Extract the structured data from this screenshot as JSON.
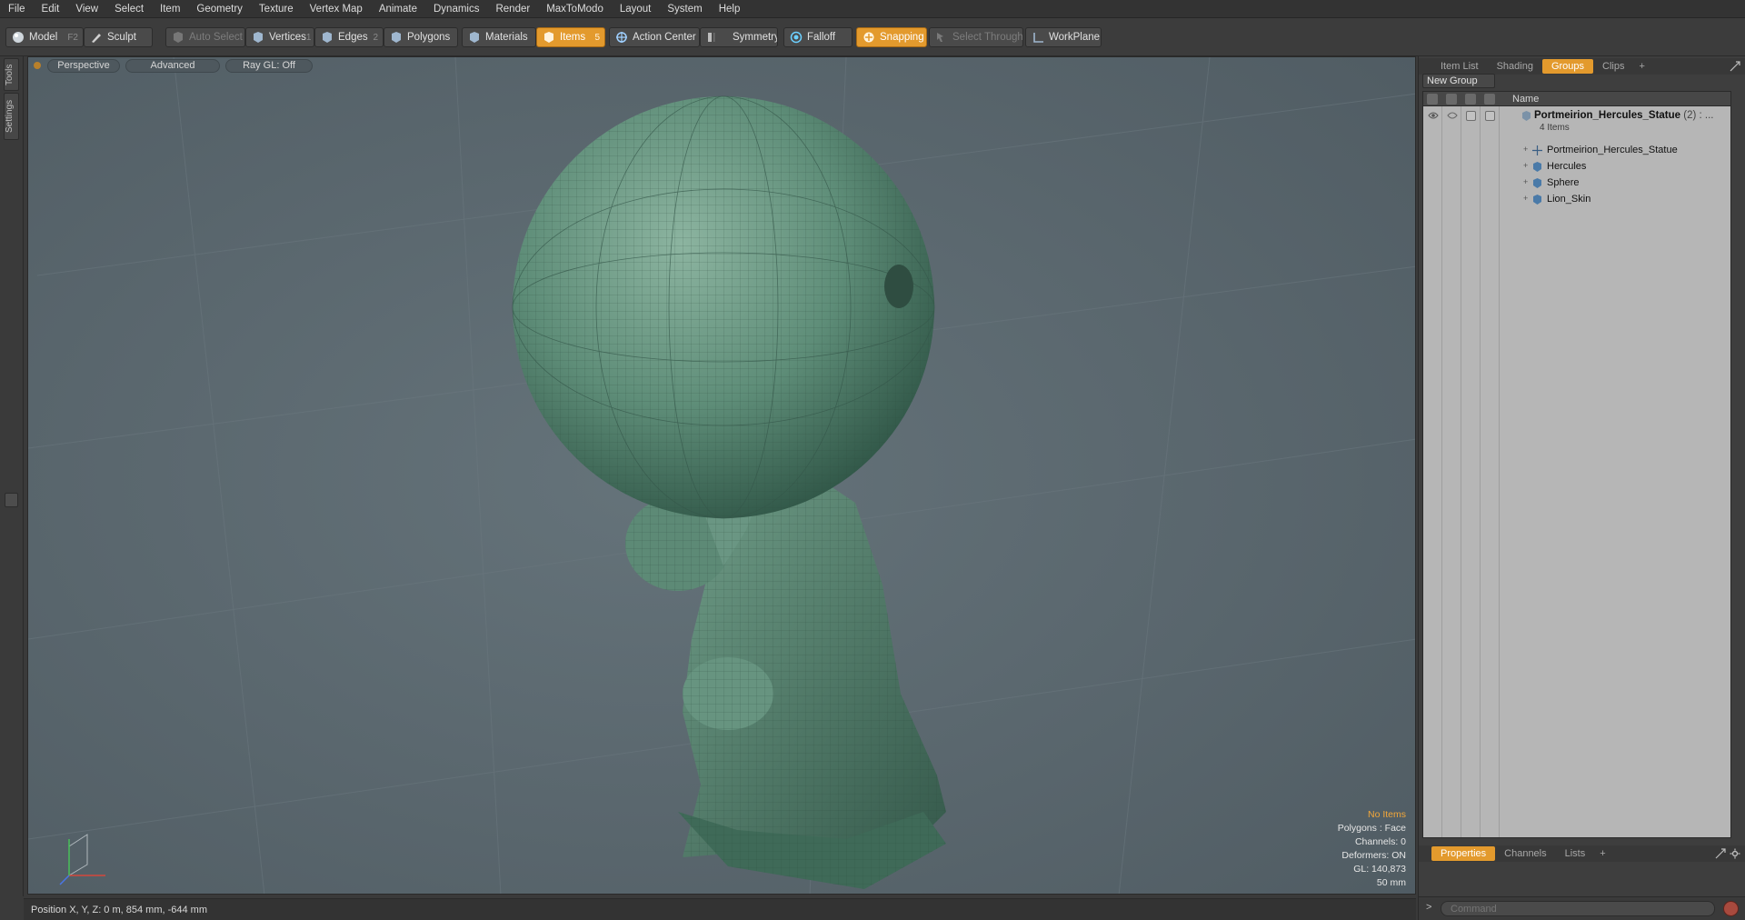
{
  "menu": [
    "File",
    "Edit",
    "View",
    "Select",
    "Item",
    "Geometry",
    "Texture",
    "Vertex Map",
    "Animate",
    "Dynamics",
    "Render",
    "MaxToModo",
    "Layout",
    "System",
    "Help"
  ],
  "toolbar": {
    "model": {
      "label": "Model",
      "key": "F2"
    },
    "sculpt": {
      "label": "Sculpt"
    },
    "auto_select": {
      "label": "Auto Select"
    },
    "vertices": {
      "label": "Vertices",
      "key": "1"
    },
    "edges": {
      "label": "Edges",
      "key": "2"
    },
    "polygons": {
      "label": "Polygons"
    },
    "materials": {
      "label": "Materials"
    },
    "items": {
      "label": "Items",
      "key": "5"
    },
    "action_center": {
      "label": "Action Center"
    },
    "symmetry": {
      "label": "Symmetry"
    },
    "falloff": {
      "label": "Falloff"
    },
    "snapping": {
      "label": "Snapping"
    },
    "select_through": {
      "label": "Select Through"
    },
    "workplane": {
      "label": "WorkPlane"
    }
  },
  "left_tabs": {
    "tools": "Tools",
    "settings": "Settings"
  },
  "viewport": {
    "view_mode": "Perspective",
    "shading": "Advanced",
    "raygl": "Ray GL: Off",
    "stats": {
      "selection": "No Items",
      "polygons": "Polygons : Face",
      "channels": "Channels: 0",
      "deformers": "Deformers: ON",
      "gl": "GL: 140,873",
      "focal": "50 mm"
    }
  },
  "status": {
    "position": "Position X, Y, Z:   0 m, 854 mm, -644 mm"
  },
  "right_panel": {
    "top_tabs": [
      "Item List",
      "Shading",
      "Groups",
      "Clips"
    ],
    "active_top_tab": "Groups",
    "new_group": "New Group",
    "list_header": "Name",
    "group": {
      "name": "Portmeirion_Hercules_Statue",
      "count": "(2) : ...",
      "sub": "4 Items"
    },
    "children": [
      {
        "name": "Portmeirion_Hercules_Statue",
        "icon": "locator-icon"
      },
      {
        "name": "Hercules",
        "icon": "mesh-icon"
      },
      {
        "name": "Sphere",
        "icon": "mesh-icon"
      },
      {
        "name": "Lion_Skin",
        "icon": "mesh-icon"
      }
    ],
    "bottom_tabs": [
      "Properties",
      "Channels",
      "Lists"
    ],
    "active_bottom_tab": "Properties",
    "command_placeholder": "Command",
    "command_prompt": ">"
  },
  "colors": {
    "accent": "#e39a2d",
    "viewport_bg": "#5a666d",
    "statue": "#5f8f7a"
  }
}
